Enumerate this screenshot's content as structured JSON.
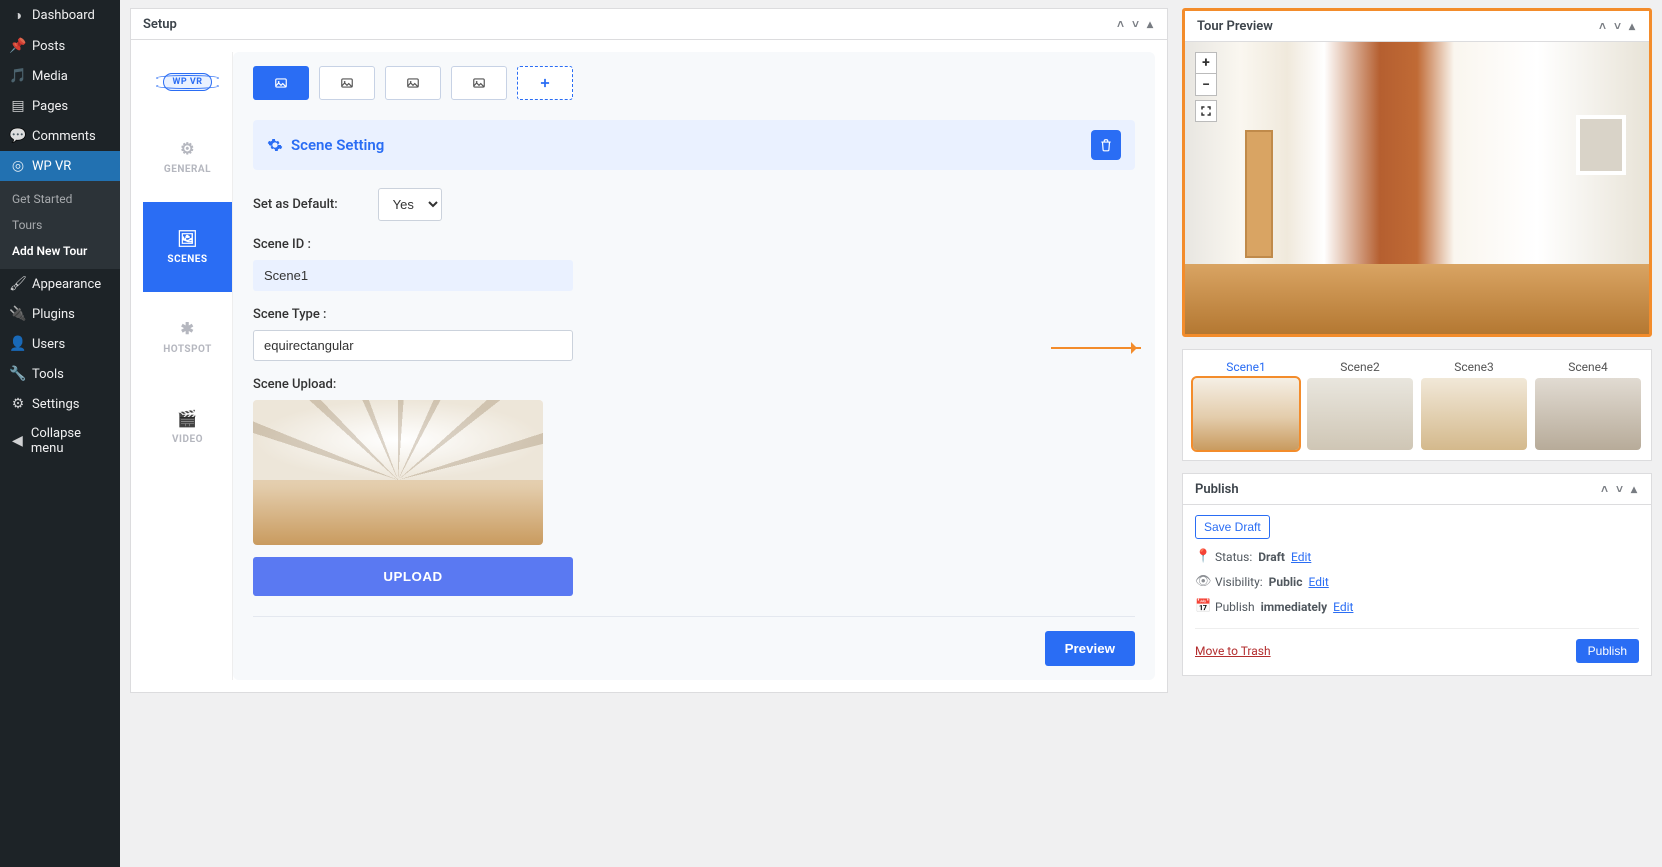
{
  "sidebar": {
    "items": [
      {
        "icon": "dashboard",
        "label": "Dashboard"
      },
      {
        "icon": "pin",
        "label": "Posts"
      },
      {
        "icon": "media",
        "label": "Media"
      },
      {
        "icon": "page",
        "label": "Pages"
      },
      {
        "icon": "comment",
        "label": "Comments"
      },
      {
        "icon": "wpvr",
        "label": "WP VR"
      },
      {
        "icon": "appearance",
        "label": "Appearance"
      },
      {
        "icon": "plugin",
        "label": "Plugins"
      },
      {
        "icon": "users",
        "label": "Users"
      },
      {
        "icon": "tools",
        "label": "Tools"
      },
      {
        "icon": "settings",
        "label": "Settings"
      },
      {
        "icon": "collapse",
        "label": "Collapse menu"
      }
    ],
    "sub": {
      "get_started": "Get Started",
      "tours": "Tours",
      "add_new": "Add New Tour"
    }
  },
  "setup": {
    "header": "Setup",
    "tabs": {
      "general": "GENERAL",
      "scenes": "SCENES",
      "hotspot": "HOTSPOT",
      "video": "VIDEO",
      "logo": "WP VR"
    },
    "scene_setting_title": "Scene Setting",
    "set_default_label": "Set as Default:",
    "set_default_value": "Yes",
    "scene_id_label": "Scene ID :",
    "scene_id_value": "Scene1",
    "scene_type_label": "Scene Type :",
    "scene_type_value": "equirectangular",
    "scene_upload_label": "Scene Upload:",
    "upload_btn": "UPLOAD",
    "preview_btn": "Preview"
  },
  "tour_preview": {
    "header": "Tour Preview",
    "scenes": [
      "Scene1",
      "Scene2",
      "Scene3",
      "Scene4"
    ]
  },
  "publish": {
    "header": "Publish",
    "save_draft": "Save Draft",
    "status_label": "Status:",
    "status_value": "Draft",
    "visibility_label": "Visibility:",
    "visibility_value": "Public",
    "publish_label": "Publish",
    "publish_value": "immediately",
    "edit": "Edit",
    "move_trash": "Move to Trash",
    "publish_btn": "Publish"
  }
}
